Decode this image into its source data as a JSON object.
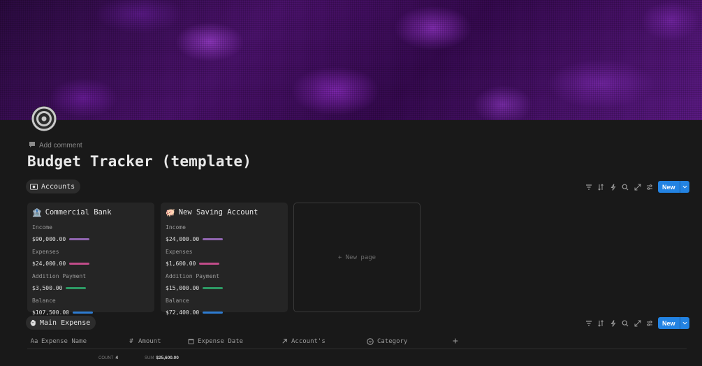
{
  "page": {
    "title": "Budget Tracker (template)",
    "add_comment": "Add comment"
  },
  "views": {
    "accounts": {
      "label": "Accounts",
      "icon": "banknote-icon"
    },
    "expense": {
      "label": "Main Expense",
      "icon": "hand-icon"
    }
  },
  "toolbar": {
    "new_label": "New"
  },
  "accounts": [
    {
      "name": "Commercial Bank",
      "emoji": "🏦",
      "props": [
        {
          "label": "Income",
          "value": "$90,000.00",
          "bar_color": "#9065b0"
        },
        {
          "label": "Expenses",
          "value": "$24,000.00",
          "bar_color": "#c14c8a"
        },
        {
          "label": "Addition Payment",
          "value": "$3,500.00",
          "bar_color": "#2d9964"
        },
        {
          "label": "Balance",
          "value": "$107,500.00",
          "bar_color": "#2e7cd1"
        }
      ]
    },
    {
      "name": "New Saving Account",
      "emoji": "🐖",
      "props": [
        {
          "label": "Income",
          "value": "$24,000.00",
          "bar_color": "#9065b0"
        },
        {
          "label": "Expenses",
          "value": "$1,600.00",
          "bar_color": "#c14c8a"
        },
        {
          "label": "Addition Payment",
          "value": "$15,000.00",
          "bar_color": "#2d9964"
        },
        {
          "label": "Balance",
          "value": "$72,400.00",
          "bar_color": "#2e7cd1"
        }
      ]
    }
  ],
  "new_page_label": "+ New page",
  "table": {
    "columns": [
      {
        "label": "Expense Name",
        "icon": "Aa"
      },
      {
        "label": "Amount",
        "icon": "#"
      },
      {
        "label": "Expense Date",
        "icon": "calendar-icon"
      },
      {
        "label": "Account's",
        "icon": "relation-arrow-icon"
      },
      {
        "label": "Category",
        "icon": "select-circle-icon"
      }
    ],
    "count_label": "COUNT",
    "count_value": "4",
    "sum_label": "SUM",
    "sum_value": "$25,600.00"
  },
  "colors": {
    "accent": "#2383e2",
    "background": "#191919",
    "card": "#252525"
  }
}
